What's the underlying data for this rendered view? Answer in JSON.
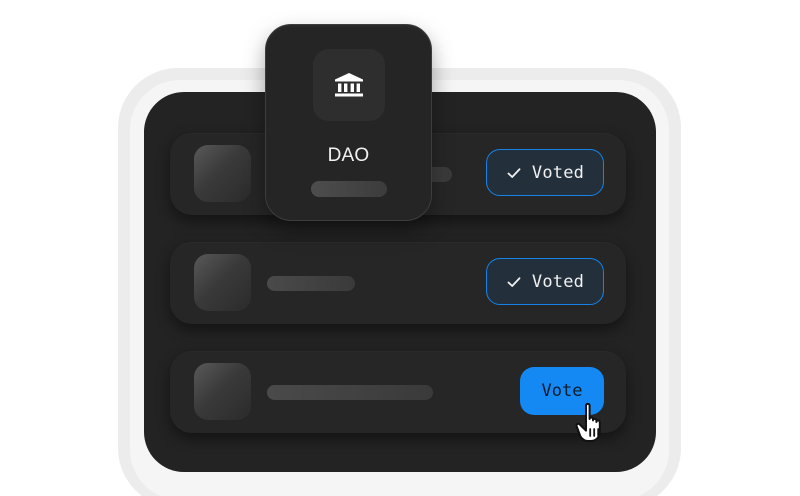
{
  "dao_card": {
    "icon": "bank-building-icon",
    "title": "DAO"
  },
  "proposals": [
    {
      "status": "voted",
      "button_label": "Voted",
      "icon": "check-icon"
    },
    {
      "status": "voted",
      "button_label": "Voted",
      "icon": "check-icon"
    },
    {
      "status": "open",
      "button_label": "Vote",
      "cursor": "pointer-hand-icon"
    }
  ],
  "colors": {
    "accent": "#1488f3",
    "voted_border": "#1583e8",
    "voted_bg": "#23303c",
    "panel": "#232323",
    "card": "#252525"
  }
}
